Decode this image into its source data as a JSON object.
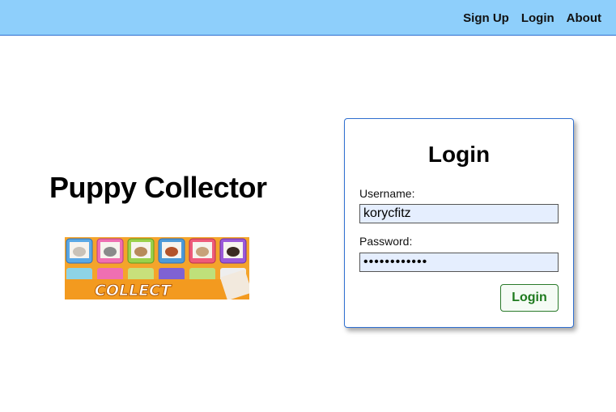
{
  "nav": {
    "items": [
      {
        "label": "Sign Up"
      },
      {
        "label": "Login"
      },
      {
        "label": "About"
      }
    ]
  },
  "hero": {
    "title": "Puppy Collector",
    "banner_text": "COLLECT"
  },
  "login_form": {
    "title": "Login",
    "username_label": "Username:",
    "username_value": "korycfitz",
    "password_label": "Password:",
    "password_value": "••••••••••••",
    "submit_label": "Login"
  },
  "colors": {
    "navbar": "#8ecffb",
    "accent_border": "#2f6fd0",
    "button_text": "#1e7a1e",
    "input_fill": "#e5eefe"
  }
}
